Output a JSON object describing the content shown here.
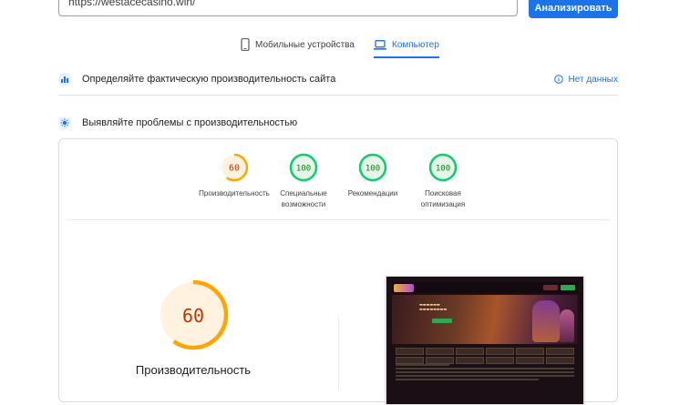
{
  "search": {
    "value": "https://westacecasino.win/"
  },
  "toolbar": {
    "analyze_label": "Анализировать"
  },
  "tabs": [
    {
      "label": "Мобильные устройства",
      "icon": "phone-icon",
      "active": false
    },
    {
      "label": "Компьютер",
      "icon": "laptop-icon",
      "active": true
    }
  ],
  "field_data": {
    "title": "Определяйте фактическую производительность сайта",
    "no_data_label": "Нет данных",
    "icon": "info-icon"
  },
  "lab_data": {
    "title": "Выявляйте проблемы с производительностью"
  },
  "scores": [
    {
      "value": "60",
      "label": "Производительность",
      "color": "#ffa400",
      "fill": 0.6
    },
    {
      "value": "100",
      "label": "Специальные возможности",
      "color": "#0cce6b",
      "fill": 1.0
    },
    {
      "value": "100",
      "label": "Рекомендации",
      "color": "#0cce6b",
      "fill": 1.0
    },
    {
      "value": "100",
      "label": "Поисковая оптимизация",
      "color": "#0cce6b",
      "fill": 1.0
    }
  ],
  "main_score": {
    "value": "60",
    "label": "Производительность",
    "color": "#ffa400",
    "fill": 0.6
  },
  "colors": {
    "accent": "#1a73e8",
    "average": "#ffa400",
    "pass": "#0cce6b"
  }
}
